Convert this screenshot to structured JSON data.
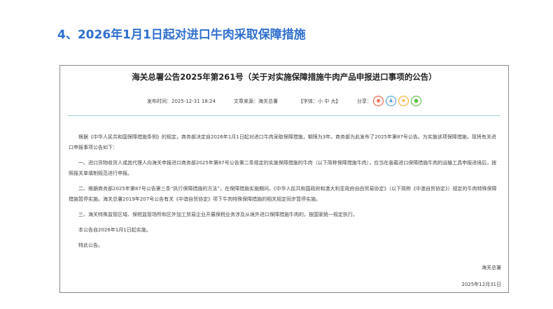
{
  "heading": "4、2026年1月1日起对进口牛肉采取保障措施",
  "notice": {
    "title": "海关总署公告2025年第261号（关于对实施保障措施牛肉产品申报进口事项的公告）",
    "meta": {
      "publish_time": "发布时间：2025-12-31 18:24",
      "source": "文章来源：海关总署",
      "font_size_label": "【字体：小 中 大】",
      "share_label": "分享："
    },
    "share_icons": [
      {
        "name": "weibo-icon",
        "glyph": "◉",
        "color": "#e8553a"
      },
      {
        "name": "qq-icon",
        "glyph": "♟",
        "color": "#3aa0e8"
      },
      {
        "name": "qzone-icon",
        "glyph": "★",
        "color": "#f2b01e"
      },
      {
        "name": "wechat-icon",
        "glyph": "●",
        "color": "#4bbf3a"
      }
    ],
    "paragraphs": [
      "根据《中华人民共和国保障措施条例》的规定，商务部决定自2026年1月1日起对进口牛肉采取保障措施，期限为3年。商务部为此发布了2025年第87号公告。为实施该项保障措施，现将有关进口申报事项公告如下：",
      "一、进口货物收货人或其代理人向海关申报进口商务部2025年第87号公告第二条规定的实施保障措施的牛肉（以下简称保障措施牛肉），应当在装载进口保障措施牛肉的运输工具申报进境后，按照报关单填制规范进行申报。",
      "二、根据商务部2025年第87号公告第三条“执行保障措施的方法”，在保障措施实施期间，《中华人民共和国政府和澳大利亚政府自由贸易协定》（以下简称《中澳自贸协定》）规定的牛肉特殊保障措施暂停实施。海关总署2019年207号公告有关《中澳自贸协定》项下牛肉特殊保障措施的相关规定同步暂停实施。",
      "三、海关特殊监管区域、保税监管场所和区外加工贸易企业开展保税业务涉及从境外进口保障措施牛肉的，按国家统一规定执行。",
      "本公告自2026年1月1日起实施。",
      "特此公告。"
    ],
    "signature": "海关总署",
    "date": "2025年12月31日"
  }
}
